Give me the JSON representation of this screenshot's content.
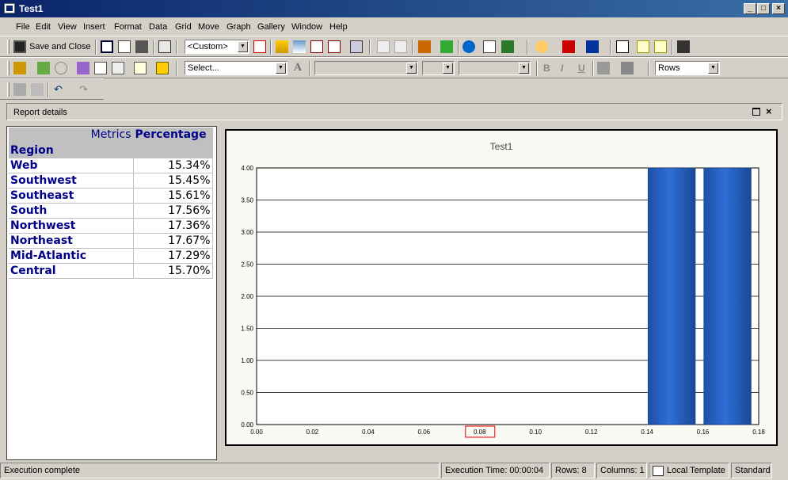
{
  "window": {
    "title": "Test1"
  },
  "menu": [
    "File",
    "Edit",
    "View",
    "Insert",
    "Format",
    "Data",
    "Grid",
    "Move",
    "Graph",
    "Gallery",
    "Window",
    "Help"
  ],
  "toolbar": {
    "save_close": "Save and Close",
    "template_combo": "<Custom>",
    "select_combo": "Select...",
    "rows_combo": "Rows"
  },
  "panel": {
    "title": "Report details"
  },
  "grid": {
    "metrics_label": "Metrics",
    "metric": "Percentage",
    "region_label": "Region",
    "rows": [
      {
        "region": "Web",
        "value": "15.34%"
      },
      {
        "region": "Southwest",
        "value": "15.45%"
      },
      {
        "region": "Southeast",
        "value": "15.61%"
      },
      {
        "region": "South",
        "value": "17.56%"
      },
      {
        "region": "Northwest",
        "value": "17.36%"
      },
      {
        "region": "Northeast",
        "value": "17.67%"
      },
      {
        "region": "Mid-Atlantic",
        "value": "17.29%"
      },
      {
        "region": "Central",
        "value": "15.70%"
      }
    ]
  },
  "chart_data": {
    "type": "bar",
    "title": "Test1",
    "x_ticks": [
      "0.00",
      "0.02",
      "0.04",
      "0.06",
      "0.08",
      "0.10",
      "0.12",
      "0.14",
      "0.16",
      "0.18"
    ],
    "y_ticks": [
      "0.00",
      "0.50",
      "1.00",
      "1.50",
      "2.00",
      "2.50",
      "3.00",
      "3.50",
      "4.00"
    ],
    "xlim": [
      0,
      0.18
    ],
    "ylim": [
      0,
      4
    ],
    "bars": [
      {
        "x0": 0.1403,
        "x1": 0.1573,
        "y": 4
      },
      {
        "x0": 0.1603,
        "x1": 0.1773,
        "y": 4
      }
    ],
    "highlighted_x_tick": "0.08",
    "grid": true,
    "bar_color": "#2f6fd6"
  },
  "status": {
    "message": "Execution complete",
    "exec_time": "Execution Time: 00:00:04",
    "rows": "Rows: 8",
    "columns": "Columns: 1",
    "template": "Local Template",
    "mode": "Standard"
  }
}
